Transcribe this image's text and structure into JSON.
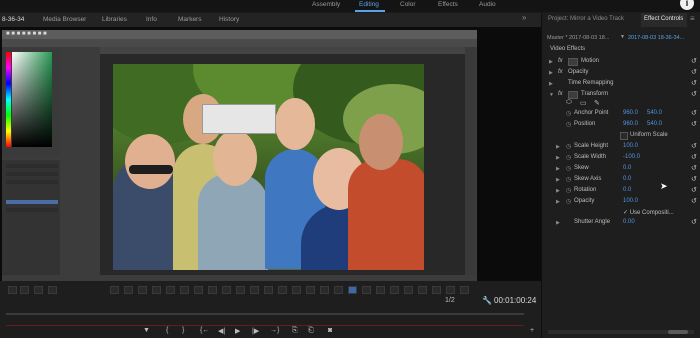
{
  "workspace": {
    "tabs": [
      "Assembly",
      "Editing",
      "Color",
      "Effects",
      "Audio"
    ],
    "active": "Editing"
  },
  "left_panel": {
    "sequence_tab": "8-36-34",
    "tabs": [
      "Media Browser",
      "Libraries",
      "Info",
      "Markers",
      "History"
    ]
  },
  "monitor": {
    "timecode": "00:01:00:24",
    "fit": "1/2"
  },
  "right_panel": {
    "tabs": [
      "Project: Mirror a Video Track",
      "Effect Controls"
    ],
    "master_label": "Master * 2017-08-03 18...",
    "master_clip": "2017-08-03 18-36-34...",
    "section_title": "Video Effects",
    "effects": [
      {
        "name": "Motion",
        "fx": true
      },
      {
        "name": "Opacity",
        "fx": true
      },
      {
        "name": "Time Remapping",
        "fx": false
      },
      {
        "name": "Transform",
        "fx": true
      }
    ],
    "transform_props": [
      {
        "name": "Anchor Point",
        "v1": "960.0",
        "v2": "540.0"
      },
      {
        "name": "Position",
        "v1": "960.0",
        "v2": "540.0"
      },
      {
        "name": "Uniform Scale",
        "v1": "",
        "v2": ""
      },
      {
        "name": "Scale Height",
        "v1": "100.0",
        "v2": ""
      },
      {
        "name": "Scale Width",
        "v1": "-100.0",
        "v2": ""
      },
      {
        "name": "Skew",
        "v1": "0.0",
        "v2": ""
      },
      {
        "name": "Skew Axis",
        "v1": "0.0",
        "v2": ""
      },
      {
        "name": "Rotation",
        "v1": "0.0",
        "v2": ""
      },
      {
        "name": "Opacity",
        "v1": "100.0",
        "v2": ""
      },
      {
        "name": "Use Composition's Shutter Angle",
        "v1": "",
        "v2": ""
      },
      {
        "name": "Shutter Angle",
        "v1": "0.00",
        "v2": ""
      }
    ],
    "use_comp_label": "✓ Use Compositi..."
  },
  "transport": {
    "buttons": [
      "marker",
      "in",
      "out",
      "go-in",
      "step-back",
      "play",
      "step-forward",
      "go-out",
      "insert",
      "overwrite",
      "export-frame"
    ]
  },
  "colors": {
    "accent": "#5aa3e8",
    "value_blue": "#4f95e0",
    "panel_bg": "#1e1e1e"
  }
}
